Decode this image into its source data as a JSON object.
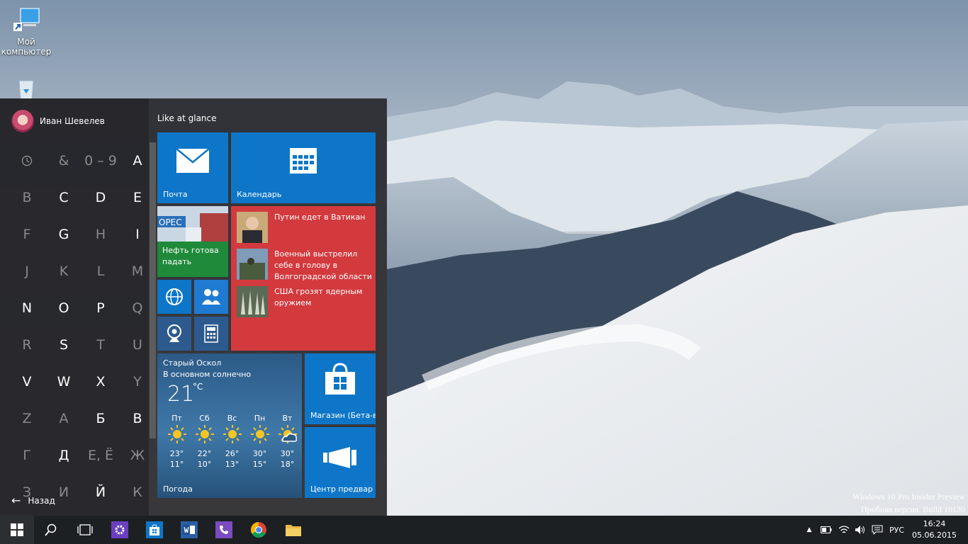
{
  "desktop": {
    "icons": [
      {
        "label": "Мой компьютер",
        "icon": "computer-icon"
      },
      {
        "label": "",
        "icon": "recycle-bin-icon"
      }
    ],
    "watermark": {
      "line1": "Windows 10 Pro Insider Preview",
      "line2": "Пробная версия. Build 10130"
    }
  },
  "start_menu": {
    "user_name": "Иван Шевелев",
    "letters": [
      {
        "label": "",
        "icon": "clock-icon",
        "active": false
      },
      {
        "label": "&",
        "active": false
      },
      {
        "label": "0 – 9",
        "active": false
      },
      {
        "label": "A",
        "active": true
      },
      {
        "label": "B",
        "active": false
      },
      {
        "label": "C",
        "active": true
      },
      {
        "label": "D",
        "active": true
      },
      {
        "label": "E",
        "active": true
      },
      {
        "label": "F",
        "active": false
      },
      {
        "label": "G",
        "active": true
      },
      {
        "label": "H",
        "active": false
      },
      {
        "label": "I",
        "active": true
      },
      {
        "label": "J",
        "active": false
      },
      {
        "label": "K",
        "active": false
      },
      {
        "label": "L",
        "active": false
      },
      {
        "label": "M",
        "active": false
      },
      {
        "label": "N",
        "active": true
      },
      {
        "label": "O",
        "active": true
      },
      {
        "label": "P",
        "active": true
      },
      {
        "label": "Q",
        "active": false
      },
      {
        "label": "R",
        "active": false
      },
      {
        "label": "S",
        "active": true
      },
      {
        "label": "T",
        "active": false
      },
      {
        "label": "U",
        "active": false
      },
      {
        "label": "V",
        "active": true
      },
      {
        "label": "W",
        "active": true
      },
      {
        "label": "X",
        "active": true
      },
      {
        "label": "Y",
        "active": false
      },
      {
        "label": "Z",
        "active": false
      },
      {
        "label": "А",
        "active": false
      },
      {
        "label": "Б",
        "active": true
      },
      {
        "label": "В",
        "active": true
      },
      {
        "label": "Г",
        "active": false
      },
      {
        "label": "Д",
        "active": true
      },
      {
        "label": "Е, Ё",
        "active": false
      },
      {
        "label": "Ж",
        "active": false
      },
      {
        "label": "З",
        "active": false
      },
      {
        "label": "И",
        "active": false
      },
      {
        "label": "Й",
        "active": true
      },
      {
        "label": "К",
        "active": false
      }
    ],
    "back_label": "Назад",
    "group_title": "Like at glance",
    "tiles": {
      "mail": {
        "label": "Почта"
      },
      "calendar": {
        "label": "Календарь"
      },
      "finance": {
        "label": "Нефть готова падать"
      },
      "news": {
        "items": [
          {
            "headline": "Путин едет в Ватикан"
          },
          {
            "headline": "Военный выстрелил себе в голову в Волгоградской области"
          },
          {
            "headline": "США грозят ядерным оружием"
          }
        ]
      },
      "weather": {
        "city": "Старый Оскол",
        "condition": "В основном солнечно",
        "temp": "21",
        "unit": "°C",
        "label": "Погода",
        "days": [
          {
            "day": "Пт",
            "high": "23°",
            "low": "11°",
            "icon": "sun-icon"
          },
          {
            "day": "Сб",
            "high": "22°",
            "low": "10°",
            "icon": "sun-icon"
          },
          {
            "day": "Вс",
            "high": "26°",
            "low": "13°",
            "icon": "sun-icon"
          },
          {
            "day": "Пн",
            "high": "30°",
            "low": "15°",
            "icon": "sun-icon"
          },
          {
            "day": "Вт",
            "high": "30°",
            "low": "18°",
            "icon": "partly-cloudy-icon"
          }
        ]
      },
      "store": {
        "label": "Магазин (Бета-в"
      },
      "feedback": {
        "label": "Центр предвар"
      }
    }
  },
  "taskbar": {
    "language": "РУС",
    "time": "16:24",
    "date": "05.06.2015"
  },
  "colors": {
    "tile_blue": "#0d76c8",
    "tile_red": "#d23a3e",
    "tile_green": "#1f8a3a",
    "taskbar": "#1c2022"
  }
}
